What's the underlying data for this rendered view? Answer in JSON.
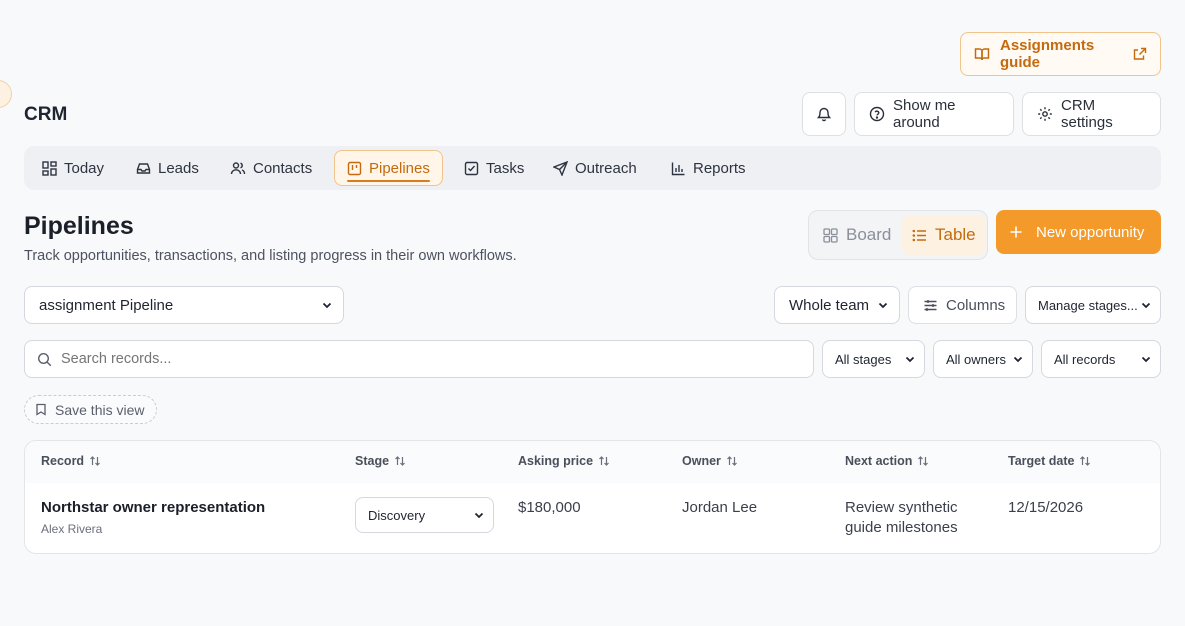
{
  "header": {
    "guide_label": "Assignments guide",
    "app_title": "CRM",
    "show_me_around": "Show me around",
    "crm_settings": "CRM settings"
  },
  "nav": {
    "tabs": [
      {
        "label": "Today",
        "icon": "grid-icon"
      },
      {
        "label": "Leads",
        "icon": "inbox-icon"
      },
      {
        "label": "Contacts",
        "icon": "users-icon"
      },
      {
        "label": "Pipelines",
        "icon": "kanban-icon",
        "active": true
      },
      {
        "label": "Tasks",
        "icon": "checkbox-icon"
      },
      {
        "label": "Outreach",
        "icon": "send-icon"
      },
      {
        "label": "Reports",
        "icon": "bar-chart-icon"
      }
    ]
  },
  "page": {
    "title": "Pipelines",
    "subtitle": "Track opportunities, transactions, and listing progress in their own workflows.",
    "view_board": "Board",
    "view_table": "Table",
    "new_button": "New opportunity"
  },
  "filters": {
    "pipeline_select": "assignment Pipeline",
    "team_select": "Whole team",
    "columns_label": "Columns",
    "manage_stages": "Manage stages...",
    "search_placeholder": "Search records...",
    "stages_select": "All stages",
    "owners_select": "All owners",
    "records_select": "All records",
    "save_view": "Save this view"
  },
  "table": {
    "columns": [
      "Record",
      "Stage",
      "Asking price",
      "Owner",
      "Next action",
      "Target date"
    ],
    "rows": [
      {
        "record": "Northstar owner representation",
        "record_sub": "Alex Rivera",
        "stage": "Discovery",
        "asking_price": "$180,000",
        "owner": "Jordan Lee",
        "next_action_1": "Review synthetic",
        "next_action_2": "guide milestones",
        "target_date": "12/15/2026"
      }
    ]
  },
  "colors": {
    "accent": "#f39a2b",
    "accent_text": "#c36b0e",
    "background": "#f8f9fb"
  }
}
